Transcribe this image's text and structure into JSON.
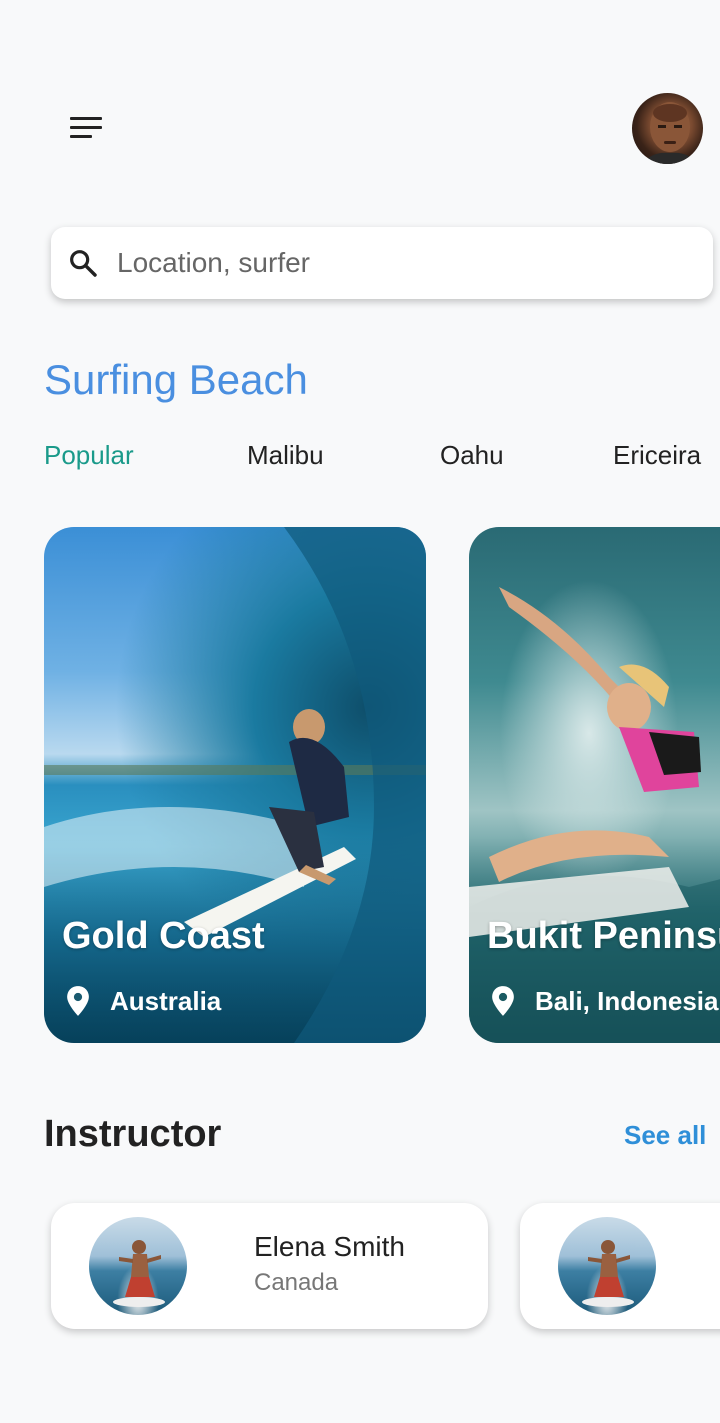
{
  "header": {
    "menu_icon": "menu-icon",
    "avatar": "user-avatar"
  },
  "search": {
    "placeholder": "Location, surfer",
    "value": "",
    "icon": "search-icon"
  },
  "section": {
    "title": "Surfing Beach"
  },
  "tabs": [
    {
      "label": "Popular",
      "active": true
    },
    {
      "label": "Malibu",
      "active": false
    },
    {
      "label": "Oahu",
      "active": false
    },
    {
      "label": "Ericeira",
      "active": false
    }
  ],
  "beaches": [
    {
      "name": "Gold Coast",
      "location": "Australia"
    },
    {
      "name": "Bukit Peninsula",
      "location": "Bali, Indonesia"
    }
  ],
  "instructors": {
    "title": "Instructor",
    "see_all": "See all",
    "items": [
      {
        "name": "Elena Smith",
        "country": "Canada"
      },
      {
        "name": "",
        "country": ""
      }
    ]
  },
  "colors": {
    "accent": "#4a8fe0",
    "tab_active": "#1a9a8a",
    "link": "#2f8fd8",
    "background": "#f8f9fa"
  }
}
